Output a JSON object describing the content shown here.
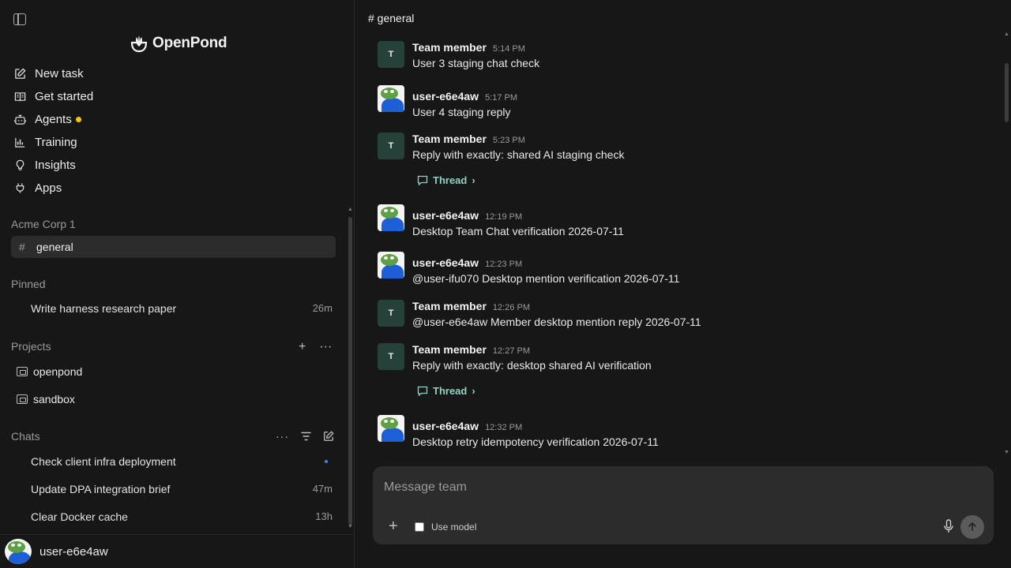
{
  "app": {
    "name": "OpenPond"
  },
  "nav": [
    {
      "label": "New task",
      "icon": "edit-icon"
    },
    {
      "label": "Get started",
      "icon": "book-icon"
    },
    {
      "label": "Agents",
      "icon": "bot-icon",
      "badge_color": "#f5c518"
    },
    {
      "label": "Training",
      "icon": "chart-icon"
    },
    {
      "label": "Insights",
      "icon": "lightbulb-icon"
    },
    {
      "label": "Apps",
      "icon": "plug-icon"
    }
  ],
  "workspace": {
    "name": "Acme Corp 1",
    "channel_hash": "#",
    "channel": "general"
  },
  "pinned": {
    "title": "Pinned",
    "items": [
      {
        "label": "Write harness research paper",
        "time": "26m"
      }
    ]
  },
  "projects": {
    "title": "Projects",
    "add": "+",
    "more": "···",
    "items": [
      {
        "label": "openpond"
      },
      {
        "label": "sandbox"
      }
    ]
  },
  "chats": {
    "title": "Chats",
    "items": [
      {
        "label": "Check client infra deployment",
        "time": ""
      },
      {
        "label": "Update DPA integration brief",
        "time": "47m"
      },
      {
        "label": "Clear Docker cache",
        "time": "13h"
      }
    ]
  },
  "user": {
    "name": "user-e6e4aw"
  },
  "channel_header": "# general",
  "messages": [
    {
      "author": "Team member",
      "time": "5:14 PM",
      "text": "User 3 staging chat check",
      "avatar": "T"
    },
    {
      "author": "user-e6e4aw",
      "time": "5:17 PM",
      "text": "User 4 staging reply",
      "avatar": "img"
    },
    {
      "author": "Team member",
      "time": "5:23 PM",
      "text": "Reply with exactly: shared AI staging check",
      "avatar": "T",
      "thread": "Thread"
    },
    {
      "author": "user-e6e4aw",
      "time": "12:19 PM",
      "text": "Desktop Team Chat verification 2026-07-11",
      "avatar": "img"
    },
    {
      "author": "user-e6e4aw",
      "time": "12:23 PM",
      "text": "@user-ifu070 Desktop mention verification 2026-07-11",
      "avatar": "img"
    },
    {
      "author": "Team member",
      "time": "12:26 PM",
      "text": "@user-e6e4aw Member desktop mention reply 2026-07-11",
      "avatar": "T"
    },
    {
      "author": "Team member",
      "time": "12:27 PM",
      "text": "Reply with exactly: desktop shared AI verification",
      "avatar": "T",
      "thread": "Thread"
    },
    {
      "author": "user-e6e4aw",
      "time": "12:32 PM",
      "text": "Desktop retry idempotency verification 2026-07-11",
      "avatar": "img"
    }
  ],
  "thread_chevron": "›",
  "avatar_letter": "T",
  "composer": {
    "placeholder": "Message team",
    "add": "+",
    "use_model_label": "Use model"
  },
  "colors": {
    "accent_thread": "#8fd1c3",
    "agents_dot": "#f5c518",
    "selected_row": "#2c2c2c"
  }
}
